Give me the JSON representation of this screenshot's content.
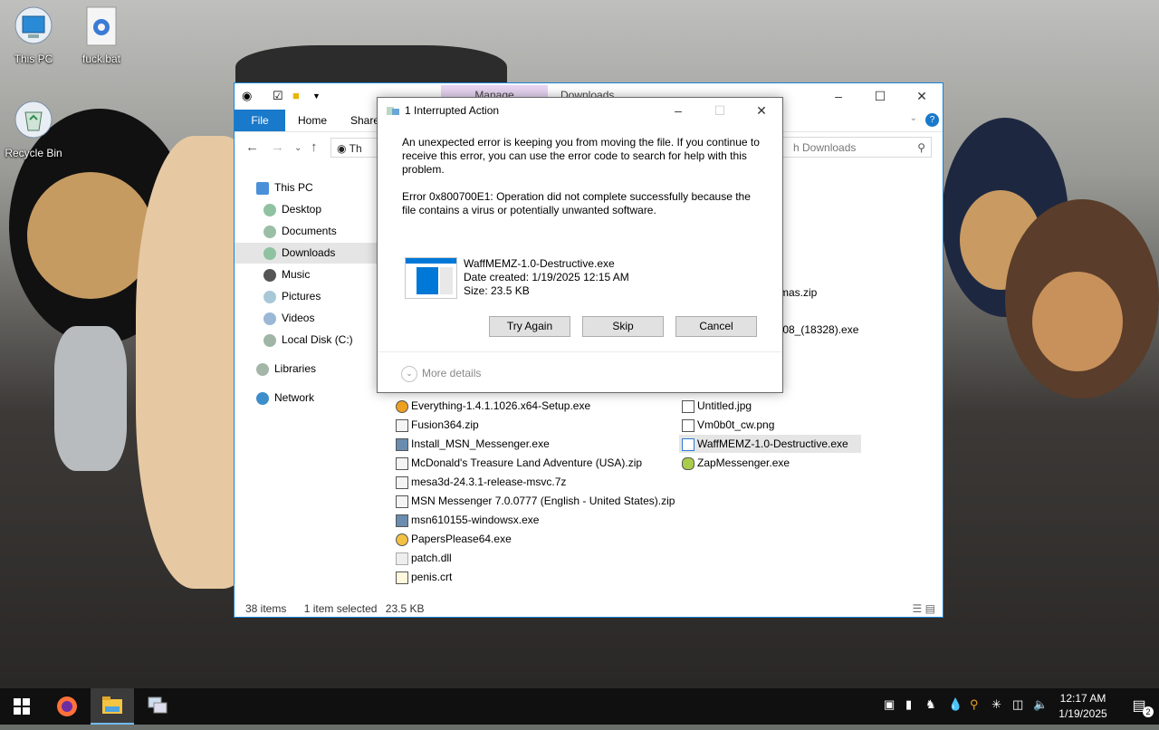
{
  "desktop": {
    "icons": [
      {
        "label": "This PC",
        "icon": "monitor-icon"
      },
      {
        "label": "fuck.bat",
        "icon": "batch-file-gear-icon"
      },
      {
        "label": "Recycle Bin",
        "icon": "recycle-bin-icon"
      }
    ]
  },
  "explorer": {
    "title_tab": "Manage",
    "title": "Downloads",
    "ribbon_tabs": [
      "File",
      "Home",
      "Share"
    ],
    "address": "Th",
    "search_placeholder": "h Downloads",
    "nav": {
      "items": [
        {
          "label": "This PC",
          "icon": "monitor-icon"
        },
        {
          "label": "Desktop",
          "icon": "folder-icon"
        },
        {
          "label": "Documents",
          "icon": "folder-icon"
        },
        {
          "label": "Downloads",
          "icon": "download-folder-icon"
        },
        {
          "label": "Music",
          "icon": "music-icon"
        },
        {
          "label": "Pictures",
          "icon": "pictures-icon"
        },
        {
          "label": "Videos",
          "icon": "videos-icon"
        },
        {
          "label": "Local Disk (C:)",
          "icon": "disk-icon"
        },
        {
          "label": "Libraries",
          "icon": "libraries-icon"
        },
        {
          "label": "Network",
          "icon": "network-icon"
        }
      ]
    },
    "files_col1": [
      "Everything-1.4.1.1026.x64-Setup.exe",
      "Fusion364.zip",
      "Install_MSN_Messenger.exe",
      "McDonald's Treasure Land Adventure (USA).zip",
      "mesa3d-24.3.1-release-msvc.7z",
      "MSN Messenger 7.0.0777 (English - United States).zip",
      "msn610155-windowsx.exe",
      "PapersPlease64.exe",
      "patch.dll",
      "penis.crt"
    ],
    "files_col2": [
      "Untitled.jpg",
      "Vm0b0t_cw.png",
      "WaffMEMZ-1.0-Destructive.exe",
      "ZapMessenger.exe"
    ],
    "partial_files": [
      "mas.zip",
      ".08_(18328).exe"
    ],
    "status": {
      "items": "38 items",
      "selected": "1 item selected",
      "size": "23.5 KB"
    }
  },
  "dialog": {
    "title": "1 Interrupted Action",
    "message": "An unexpected error is keeping you from moving the file. If you continue to receive this error, you can use the error code to search for help with this problem.",
    "error": "Error 0x800700E1: Operation did not complete successfully because the file contains a virus or potentially unwanted software.",
    "file_name": "WaffMEMZ-1.0-Destructive.exe",
    "date_created": "Date created: 1/19/2025 12:15 AM",
    "size": "Size: 23.5 KB",
    "buttons": {
      "try_again": "Try Again",
      "skip": "Skip",
      "cancel": "Cancel"
    },
    "more_details": "More details"
  },
  "taskbar": {
    "time": "12:17 AM",
    "date": "1/19/2025",
    "notification_count": "2",
    "apps": [
      "start-icon",
      "firefox-icon",
      "file-explorer-icon",
      "network-neighborhood-icon"
    ]
  }
}
